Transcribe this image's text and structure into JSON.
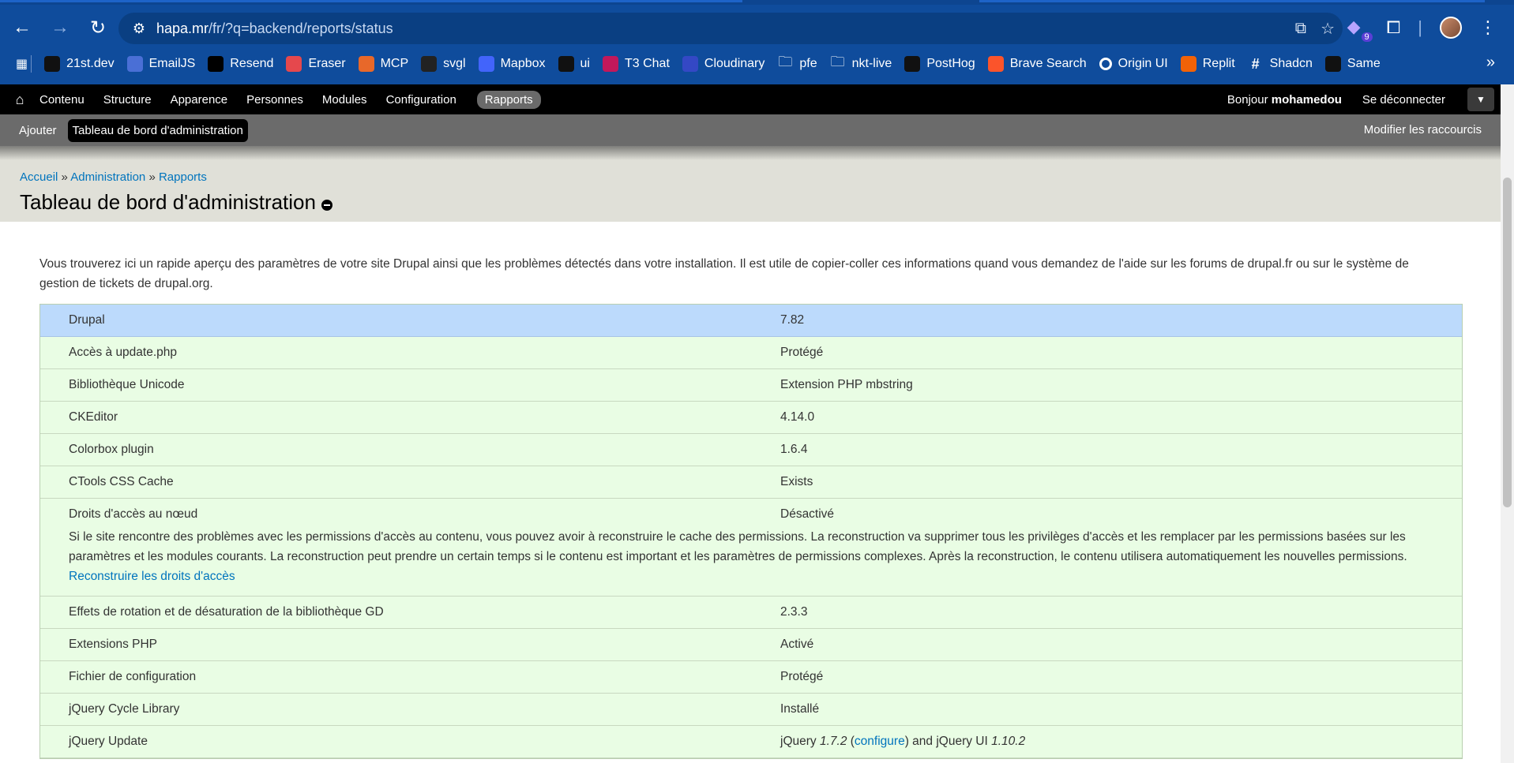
{
  "browser": {
    "url_host": "hapa.mr",
    "url_path": "/fr/?q=backend/reports/status",
    "extension_badge": "9",
    "bookmarks": [
      {
        "label": "21st.dev",
        "icon": "21st-icon",
        "color": "#111111"
      },
      {
        "label": "EmailJS",
        "icon": "emailjs-icon",
        "color": "#4a6fd6"
      },
      {
        "label": "Resend",
        "icon": "resend-icon",
        "color": "#000000"
      },
      {
        "label": "Eraser",
        "icon": "eraser-icon",
        "color": "#e5484d"
      },
      {
        "label": "MCP",
        "icon": "mcp-icon",
        "color": "#e8682a"
      },
      {
        "label": "svgl",
        "icon": "svgl-icon",
        "color": "#222222"
      },
      {
        "label": "Mapbox",
        "icon": "mapbox-icon",
        "color": "#4264fb"
      },
      {
        "label": "ui",
        "icon": "ui-icon",
        "color": "#111111"
      },
      {
        "label": "T3 Chat",
        "icon": "t3chat-icon",
        "color": "#c2185b"
      },
      {
        "label": "Cloudinary",
        "icon": "cloudinary-icon",
        "color": "#3448c5"
      },
      {
        "label": "pfe",
        "icon": "folder-icon",
        "color": "transparent"
      },
      {
        "label": "nkt-live",
        "icon": "folder-icon",
        "color": "transparent"
      },
      {
        "label": "PostHog",
        "icon": "posthog-icon",
        "color": "#111111"
      },
      {
        "label": "Brave Search",
        "icon": "brave-icon",
        "color": "#fb542b"
      },
      {
        "label": "Origin UI",
        "icon": "originui-icon",
        "color": "#ffffff"
      },
      {
        "label": "Replit",
        "icon": "replit-icon",
        "color": "#f26207"
      },
      {
        "label": "Shadcn",
        "icon": "shadcn-icon",
        "color": "transparent"
      },
      {
        "label": "Same",
        "icon": "same-icon",
        "color": "#111111"
      }
    ]
  },
  "admin_bar": {
    "menu": [
      "Contenu",
      "Structure",
      "Apparence",
      "Personnes",
      "Modules",
      "Configuration",
      "Rapports"
    ],
    "active": "Rapports",
    "hello_prefix": "Bonjour",
    "username": "mohamedou",
    "logout": "Se déconnecter"
  },
  "shortcuts": {
    "add": "Ajouter",
    "current": "Tableau de bord d'administration",
    "edit": "Modifier les raccourcis"
  },
  "breadcrumb": [
    "Accueil",
    "Administration",
    "Rapports"
  ],
  "breadcrumb_sep": "»",
  "page_title": "Tableau de bord d'administration",
  "intro": "Vous trouverez ici un rapide aperçu des paramètres de votre site Drupal ainsi que les problèmes détectés dans votre installation. Il est utile de copier-coller ces informations quand vous demandez de l'aide sur les forums de drupal.fr ou sur le système de gestion de tickets de drupal.org.",
  "status_rows": [
    {
      "key": "Drupal",
      "value": "7.82",
      "type": "info"
    },
    {
      "key": "Accès à update.php",
      "value": "Protégé"
    },
    {
      "key": "Bibliothèque Unicode",
      "value": "Extension PHP mbstring"
    },
    {
      "key": "CKEditor",
      "value": "4.14.0"
    },
    {
      "key": "Colorbox plugin",
      "value": "1.6.4"
    },
    {
      "key": "CTools CSS Cache",
      "value": "Exists"
    },
    {
      "key": "Droits d'accès au nœud",
      "value": "Désactivé",
      "description": "Si le site rencontre des problèmes avec les permissions d'accès au contenu, vous pouvez avoir à reconstruire le cache des permissions. La reconstruction va supprimer tous les privilèges d'accès et les remplacer par les permissions basées sur les paramètres et les modules courants. La reconstruction peut prendre un certain temps si le contenu est important et les paramètres de permissions complexes. Après la reconstruction, le contenu utilisera automatiquement les nouvelles permissions.",
      "link": "Reconstruire les droits d'accès"
    },
    {
      "key": "Effets de rotation et de désaturation de la bibliothèque GD",
      "value": "2.3.3"
    },
    {
      "key": "Extensions PHP",
      "value": "Activé"
    },
    {
      "key": "Fichier de configuration",
      "value": "Protégé"
    },
    {
      "key": "jQuery Cycle Library",
      "value": "Installé"
    }
  ],
  "jquery_update": {
    "key": "jQuery Update",
    "prefix": "jQuery",
    "version": "1.7.2",
    "link": "configure",
    "middle": "and jQuery UI",
    "ui_version": "1.10.2"
  },
  "colors": {
    "chrome": "#0f4c9c",
    "ok_row": "#e9fde4",
    "info_row": "#bcdafc",
    "link": "#0074bd"
  }
}
